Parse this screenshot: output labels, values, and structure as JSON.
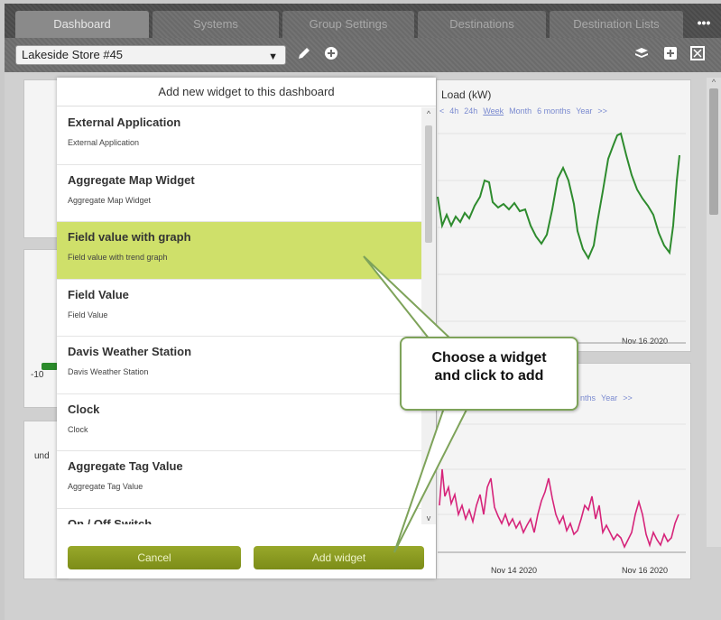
{
  "tabs": [
    {
      "label": "Dashboard",
      "active": true
    },
    {
      "label": "Systems",
      "active": false
    },
    {
      "label": "Group Settings",
      "active": false
    },
    {
      "label": "Destinations",
      "active": false
    },
    {
      "label": "Destination Lists",
      "active": false
    }
  ],
  "tab_more": "•••",
  "toolbar": {
    "dashboard_select": "Lakeside Store #45",
    "icons": [
      "chevron-down-icon",
      "pencil-icon",
      "plus-circle-icon",
      "layers-icon",
      "add-square-icon",
      "fullscreen-icon"
    ]
  },
  "background": {
    "chart1": {
      "title": "Load (kW)",
      "ranges": [
        "<",
        "4h",
        "24h",
        "Week",
        "Month",
        "6 months",
        "Year",
        ">>"
      ],
      "selected_range": "Week",
      "date_label": "Nov 16 2020"
    },
    "chart2": {
      "ranges": [
        "nths",
        "Year",
        ">>"
      ],
      "date_labels": [
        "Nov 14 2020",
        "Nov 16 2020"
      ]
    },
    "side_text_1": "-10",
    "side_text_2": "und"
  },
  "modal": {
    "title": "Add new widget to this dashboard",
    "items": [
      {
        "title": "External Application",
        "desc": "External Application"
      },
      {
        "title": "Aggregate Map Widget",
        "desc": "Aggregate Map Widget"
      },
      {
        "title": "Field value with graph",
        "desc": "Field value with trend graph",
        "highlighted": true
      },
      {
        "title": "Field Value",
        "desc": "Field Value"
      },
      {
        "title": "Davis Weather Station",
        "desc": "Davis Weather Station"
      },
      {
        "title": "Clock",
        "desc": "Clock"
      },
      {
        "title": "Aggregate Tag Value",
        "desc": "Aggregate Tag Value"
      },
      {
        "title": "On / Off Switch",
        "desc": ""
      }
    ],
    "cancel_label": "Cancel",
    "add_label": "Add widget"
  },
  "callout": {
    "line1": "Choose a widget",
    "line2": "and click to add"
  },
  "colors": {
    "highlight": "#cfe06a",
    "button": "#8a9a1e",
    "chart1_line": "#2e8b2e",
    "chart2_line": "#d6247a",
    "callout_border": "#7ea35a"
  }
}
